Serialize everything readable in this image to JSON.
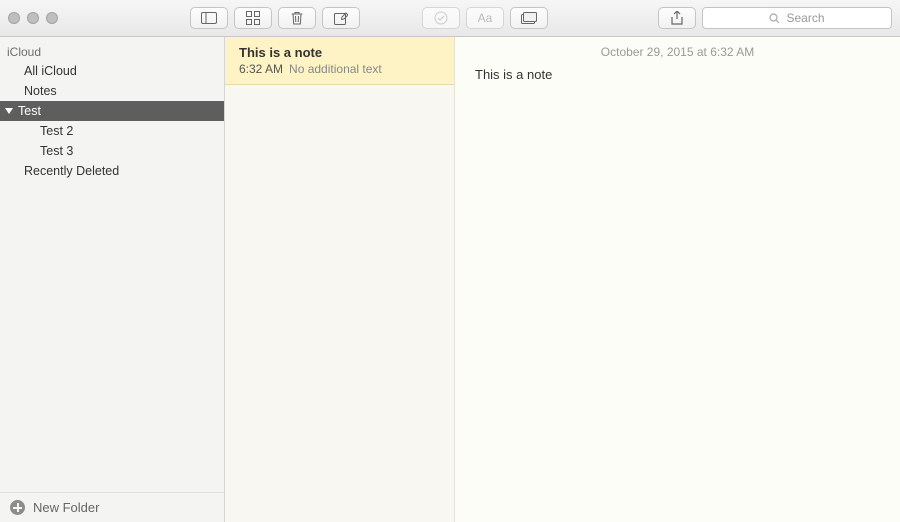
{
  "toolbar": {
    "search_placeholder": "Search"
  },
  "sidebar": {
    "section": "iCloud",
    "items": [
      {
        "label": "All iCloud"
      },
      {
        "label": "Notes"
      },
      {
        "label": "Test",
        "selected": true,
        "expanded": true
      },
      {
        "label": "Test 2",
        "sub": true
      },
      {
        "label": "Test 3",
        "sub": true
      },
      {
        "label": "Recently Deleted"
      }
    ],
    "footer_label": "New Folder"
  },
  "notelist": {
    "notes": [
      {
        "title": "This is a note",
        "time": "6:32 AM",
        "snippet": "No additional text"
      }
    ]
  },
  "editor": {
    "timestamp": "October 29, 2015 at 6:32 AM",
    "body": "This is a note"
  }
}
